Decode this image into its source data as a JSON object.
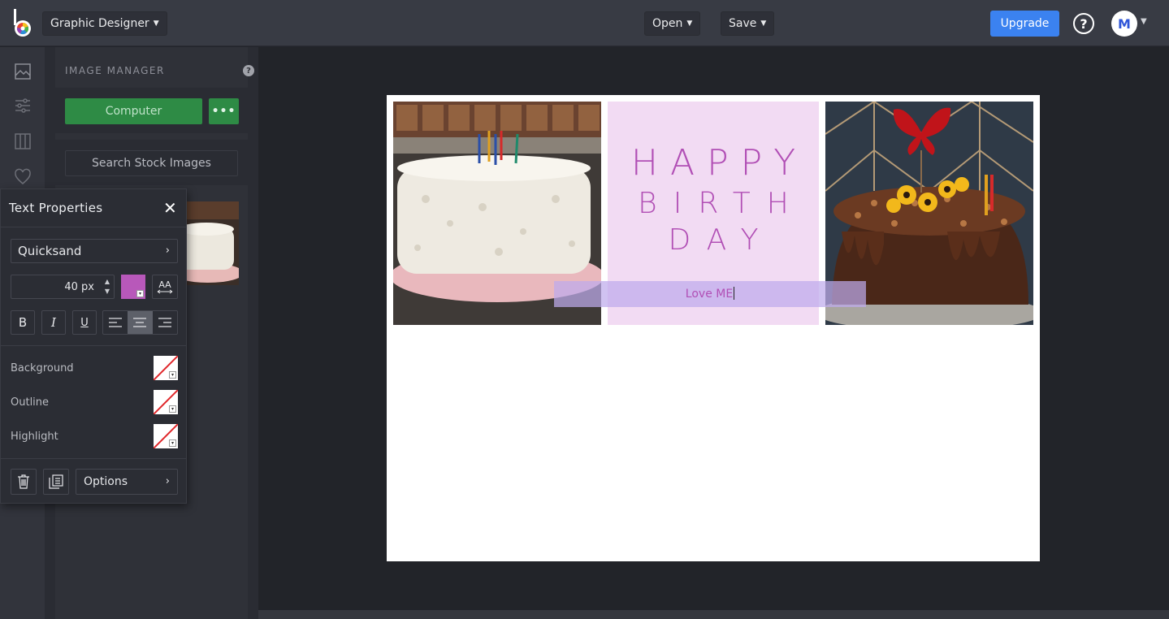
{
  "header": {
    "app_menu_label": "Graphic Designer",
    "open_label": "Open",
    "save_label": "Save",
    "upgrade_label": "Upgrade",
    "help_glyph": "?",
    "avatar_initial": "M",
    "chevron_glyph": "⌄"
  },
  "sidebar": {
    "icons": [
      "image-icon",
      "sliders-icon",
      "layout-columns-icon",
      "heart-icon"
    ]
  },
  "image_manager": {
    "title": "IMAGE MANAGER",
    "help_glyph": "?",
    "computer_label": "Computer",
    "more_label": "•••",
    "stock_label": "Search Stock Images"
  },
  "text_properties": {
    "title": "Text Properties",
    "close_glyph": "✕",
    "font_name": "Quicksand",
    "font_size": "40",
    "font_unit": "px",
    "text_color": "#b858ba",
    "aa_label": "AA",
    "bold_label": "B",
    "italic_label": "I",
    "underline_label": "U",
    "background_label": "Background",
    "outline_label": "Outline",
    "highlight_label": "Highlight",
    "options_label": "Options",
    "arrow_glyph": "›"
  },
  "canvas": {
    "card_line1": "HAPPY",
    "card_line2": "BIRTH",
    "card_line3": "DAY",
    "selected_text": "Love ME",
    "accent_text_color": "#b14fb5",
    "card_background": "#f2dbf3"
  }
}
